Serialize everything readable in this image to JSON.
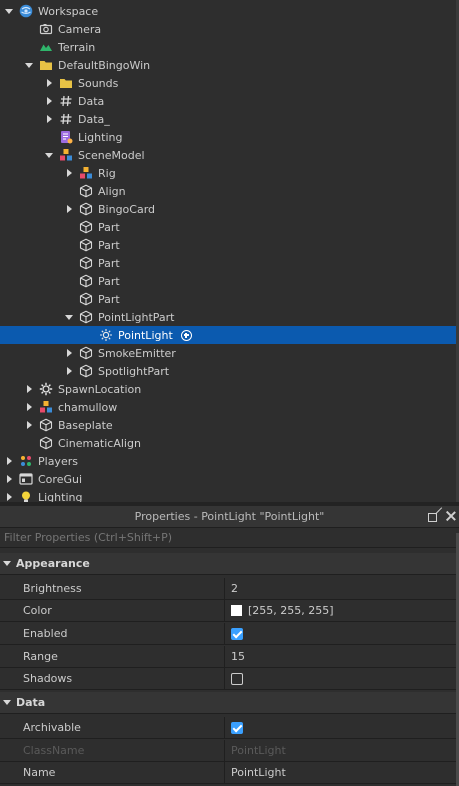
{
  "explorer": {
    "items": [
      {
        "label": "Workspace",
        "icon": "workspace-icon",
        "arrow": "expanded"
      },
      {
        "label": "Camera",
        "icon": "camera-icon",
        "arrow": "none"
      },
      {
        "label": "Terrain",
        "icon": "terrain-icon",
        "arrow": "none"
      },
      {
        "label": "DefaultBingoWin",
        "icon": "folder-icon",
        "arrow": "expanded"
      },
      {
        "label": "Sounds",
        "icon": "folder-icon",
        "arrow": "collapsed"
      },
      {
        "label": "Data",
        "icon": "value-icon",
        "arrow": "collapsed"
      },
      {
        "label": "Data_",
        "icon": "value-icon",
        "arrow": "collapsed"
      },
      {
        "label": "Lighting",
        "icon": "script-icon",
        "arrow": "none"
      },
      {
        "label": "SceneModel",
        "icon": "model-icon",
        "arrow": "expanded"
      },
      {
        "label": "Rig",
        "icon": "model-icon",
        "arrow": "collapsed"
      },
      {
        "label": "Align",
        "icon": "part-icon",
        "arrow": "none"
      },
      {
        "label": "BingoCard",
        "icon": "part-icon",
        "arrow": "collapsed"
      },
      {
        "label": "Part",
        "icon": "part-icon",
        "arrow": "none"
      },
      {
        "label": "Part",
        "icon": "part-icon",
        "arrow": "none"
      },
      {
        "label": "Part",
        "icon": "part-icon",
        "arrow": "none"
      },
      {
        "label": "Part",
        "icon": "part-icon",
        "arrow": "none"
      },
      {
        "label": "Part",
        "icon": "part-icon",
        "arrow": "none"
      },
      {
        "label": "PointLightPart",
        "icon": "part-icon",
        "arrow": "expanded"
      },
      {
        "label": "PointLight",
        "icon": "pointlight-icon",
        "arrow": "none",
        "selected": true
      },
      {
        "label": "SmokeEmitter",
        "icon": "part-icon",
        "arrow": "collapsed"
      },
      {
        "label": "SpotlightPart",
        "icon": "part-icon",
        "arrow": "collapsed"
      },
      {
        "label": "SpawnLocation",
        "icon": "spawn-icon",
        "arrow": "collapsed"
      },
      {
        "label": "chamullow",
        "icon": "model-icon",
        "arrow": "collapsed"
      },
      {
        "label": "Baseplate",
        "icon": "part-icon",
        "arrow": "collapsed"
      },
      {
        "label": "CinematicAlign",
        "icon": "part-icon",
        "arrow": "none"
      },
      {
        "label": "Players",
        "icon": "players-icon",
        "arrow": "collapsed"
      },
      {
        "label": "CoreGui",
        "icon": "coregui-icon",
        "arrow": "collapsed"
      },
      {
        "label": "Lighting",
        "icon": "lighting-icon",
        "arrow": "collapsed"
      }
    ]
  },
  "properties": {
    "title": "Properties - PointLight \"PointLight\"",
    "filter_placeholder": "Filter Properties (Ctrl+Shift+P)",
    "sections": {
      "appearance": "Appearance",
      "data": "Data"
    },
    "rows": {
      "brightness": {
        "name": "Brightness",
        "value": "2"
      },
      "color": {
        "name": "Color",
        "value": "[255, 255, 255]",
        "swatch": "#ffffff"
      },
      "enabled": {
        "name": "Enabled",
        "checked": true
      },
      "range": {
        "name": "Range",
        "value": "15"
      },
      "shadows": {
        "name": "Shadows",
        "checked": false
      },
      "archivable": {
        "name": "Archivable",
        "checked": true
      },
      "classname": {
        "name": "ClassName",
        "value": "PointLight"
      },
      "name": {
        "name": "Name",
        "value": "PointLight"
      }
    }
  },
  "colors": {
    "background": "#2e2e2e",
    "selection": "#0b5aaf",
    "checkbox_checked": "#3aa0ff"
  }
}
